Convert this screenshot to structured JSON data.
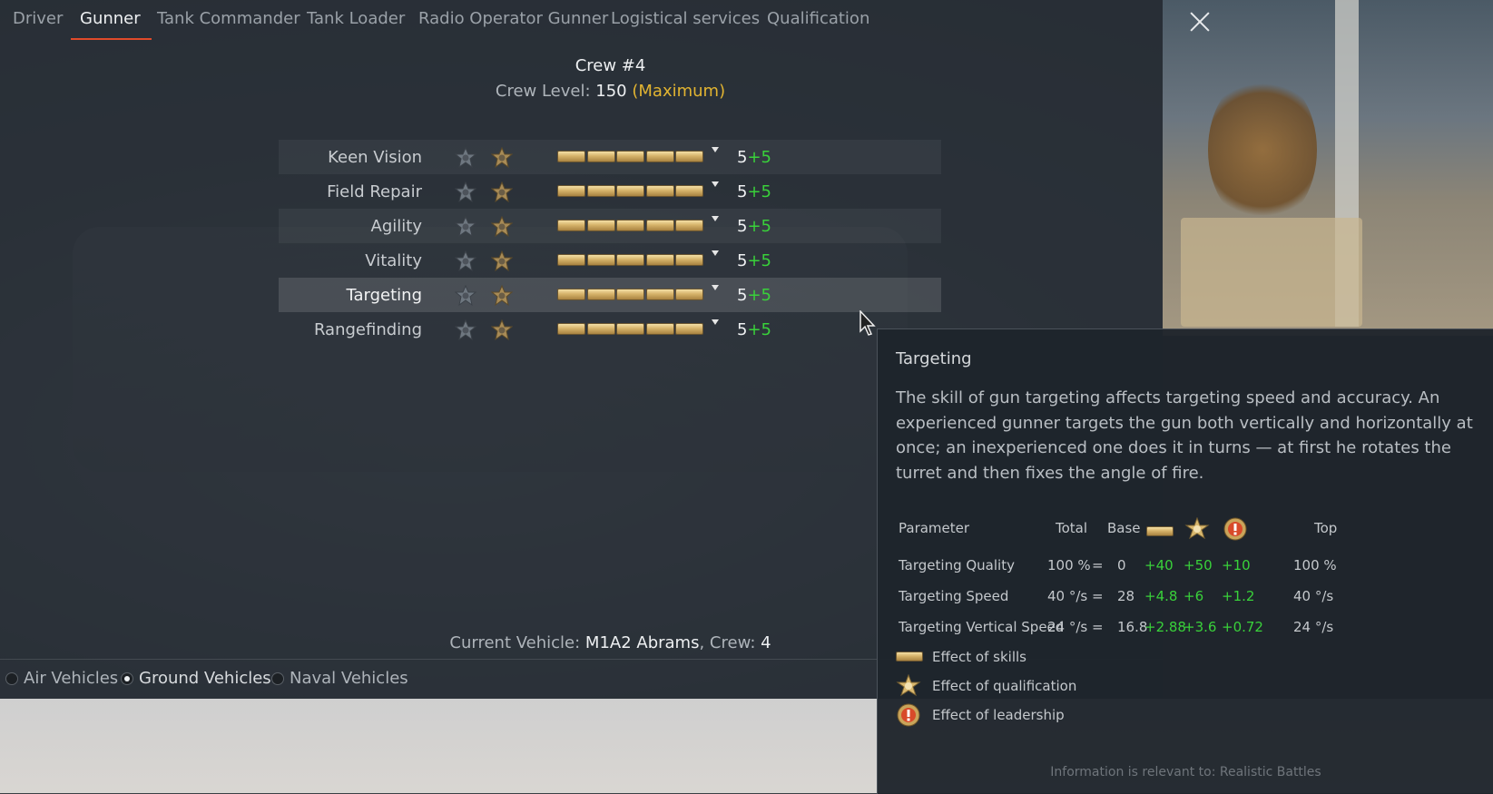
{
  "tabs": [
    "Driver",
    "Gunner",
    "Tank Commander",
    "Tank Loader",
    "Radio Operator Gunner",
    "Logistical services",
    "Qualification"
  ],
  "active_tab": "Gunner",
  "crew": {
    "title": "Crew #4",
    "level_label": "Crew Level:",
    "level_value": "150",
    "level_max": "(Maximum)"
  },
  "skills": [
    {
      "name": "Keen Vision",
      "value": "5",
      "bonus": "+5"
    },
    {
      "name": "Field Repair",
      "value": "5",
      "bonus": "+5"
    },
    {
      "name": "Agility",
      "value": "5",
      "bonus": "+5"
    },
    {
      "name": "Vitality",
      "value": "5",
      "bonus": "+5"
    },
    {
      "name": "Targeting",
      "value": "5",
      "bonus": "+5"
    },
    {
      "name": "Rangefinding",
      "value": "5",
      "bonus": "+5"
    }
  ],
  "selected_skill": "Targeting",
  "current_vehicle": {
    "label": "Current Vehicle:",
    "name": "M1A2 Abrams",
    "crew_label": ", Crew:",
    "crew_count": "4"
  },
  "vehicle_types": [
    {
      "label": "Air Vehicles",
      "selected": false
    },
    {
      "label": "Ground Vehicles",
      "selected": true
    },
    {
      "label": "Naval Vehicles",
      "selected": false
    }
  ],
  "tooltip": {
    "title": "Targeting",
    "description": "The skill of gun targeting affects targeting speed and accuracy. An experienced gunner targets the gun both vertically and horizontally at once; an inexperienced one does it in turns — at first he rotates the turret and then fixes the angle of fire.",
    "headers": {
      "parameter": "Parameter",
      "total": "Total",
      "base": "Base",
      "top": "Top"
    },
    "rows": [
      {
        "parameter": "Targeting Quality",
        "total": "100 %",
        "eq": "=",
        "base": "0",
        "skills": "+40",
        "qual": "+50",
        "lead": "+10",
        "top": "100 %"
      },
      {
        "parameter": "Targeting Speed",
        "total": "40 °/s",
        "eq": "=",
        "base": "28",
        "skills": "+4.8",
        "qual": "+6",
        "lead": "+1.2",
        "top": "40 °/s"
      },
      {
        "parameter": "Targeting Vertical Speed",
        "total": "24 °/s",
        "eq": "=",
        "base": "16.8",
        "skills": "+2.88",
        "qual": "+3.6",
        "lead": "+0.72",
        "top": "24 °/s"
      }
    ],
    "legend": [
      {
        "icon": "skill-bar-icon",
        "label": "Effect of skills"
      },
      {
        "icon": "qualification-star-icon",
        "label": "Effect of qualification"
      },
      {
        "icon": "leadership-medal-icon",
        "label": "Effect of leadership"
      }
    ],
    "footer": "Information is relevant to: Realistic Battles"
  },
  "colors": {
    "accent_underline": "#e04a2a",
    "bonus_green": "#39d13a",
    "maximum_gold": "#e2b431"
  }
}
